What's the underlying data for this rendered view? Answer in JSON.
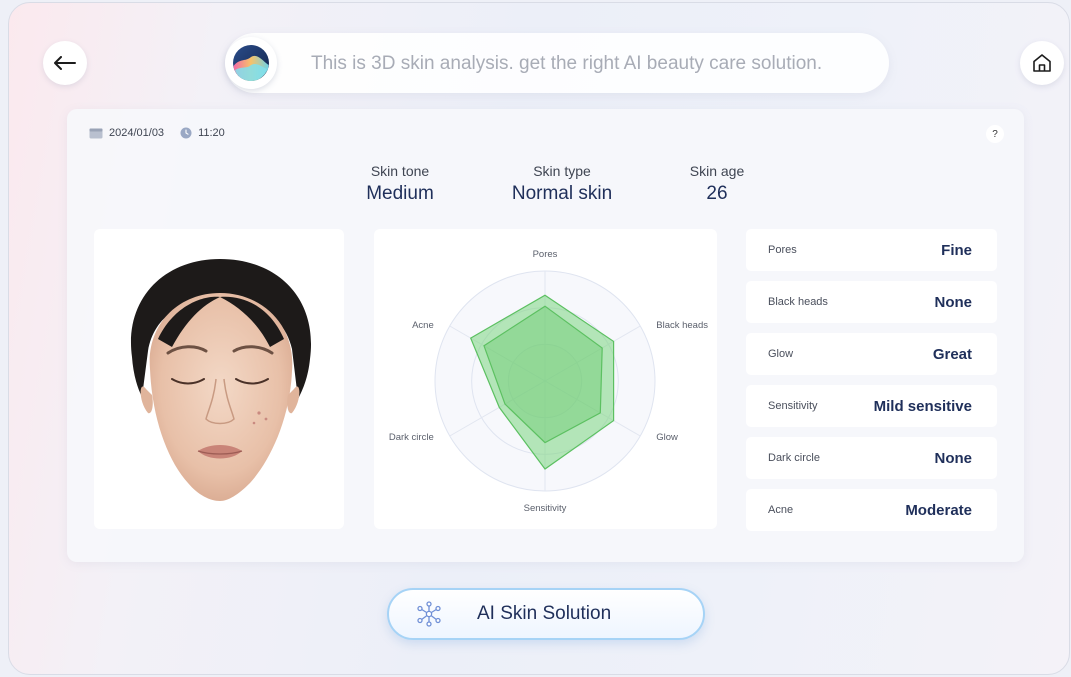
{
  "header": {
    "assistant_message": "This is 3D skin analysis. get the right AI beauty care solution."
  },
  "icons": {
    "back": "arrow-left-icon",
    "home": "home-icon",
    "assistant": "assistant-logo-icon",
    "calendar": "calendar-icon",
    "clock": "clock-icon",
    "help": "help-icon",
    "solution": "molecule-icon"
  },
  "report": {
    "date": "2024/01/03",
    "time": "11:20",
    "help_label": "?",
    "summary": [
      {
        "label": "Skin tone",
        "value": "Medium"
      },
      {
        "label": "Skin type",
        "value": "Normal skin"
      },
      {
        "label": "Skin age",
        "value": "26"
      }
    ],
    "metrics": [
      {
        "label": "Pores",
        "value": "Fine"
      },
      {
        "label": "Black heads",
        "value": "None"
      },
      {
        "label": "Glow",
        "value": "Great"
      },
      {
        "label": "Sensitivity",
        "value": "Mild sensitive"
      },
      {
        "label": "Dark circle",
        "value": "None"
      },
      {
        "label": "Acne",
        "value": "Moderate"
      }
    ]
  },
  "chart_data": {
    "type": "radar",
    "categories": [
      "Pores",
      "Black heads",
      "Glow",
      "Sensitivity",
      "Dark circle",
      "Acne"
    ],
    "series": [
      {
        "values": [
          0.78,
          0.72,
          0.72,
          0.8,
          0.48,
          0.78
        ],
        "color": "#7cd67f"
      },
      {
        "values": [
          0.68,
          0.6,
          0.58,
          0.56,
          0.42,
          0.64
        ],
        "color": "#58c45c"
      }
    ],
    "rings": 3,
    "grid": true
  },
  "footer": {
    "solution_label": "AI Skin Solution"
  },
  "colors": {
    "accent": "#1f2f5a",
    "radar_fill": "#7cd67f",
    "button_border": "#a6d3f6"
  }
}
